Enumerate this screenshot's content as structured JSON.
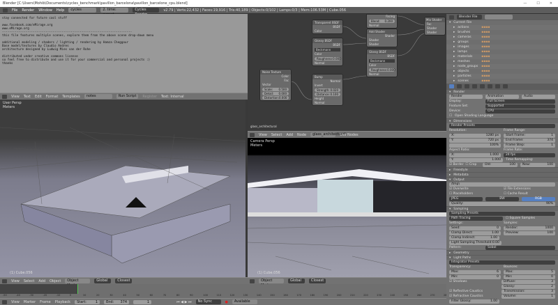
{
  "window": {
    "title": "Blender  [C:\\Users\\Mohib\\Documents\\cycles_benchmark\\pavillon_barcelona\\pavillon_barcelone_cpu.blend]",
    "controls": [
      "—",
      "☐",
      "✕"
    ]
  },
  "infobar": {
    "menus": [
      "File",
      "Render",
      "Window",
      "Help"
    ],
    "layout": "cycles",
    "scene": "2. time: sunset",
    "engine": "Cycles Render",
    "stats": "v2.79 | Verts:22,432 | Faces:19,916 | Tris:40,189 | Objects:0/102 | Lamps:0/3 | Mem:106.53M | Cube.056"
  },
  "text_editor": {
    "lines": [
      "stay connected for future cool stuff",
      "",
      "www.facebook.com/eMirage.org",
      "www.eMirage.org",
      "------------------------------------------------------------------------",
      "this file features multiple scenes, explore them from the above scene drop-down menu",
      "",
      "additional modeling / shaders / lighting / rendering by Hamza Cheggour",
      "Base model/textures by Claudio Andres",
      "architecture designed by Ludwig Mies van der Rohe",
      "",
      "distributed under creative commons license",
      "so feel free to distribute and use it for your commercial and personal projects :)",
      "thanks"
    ],
    "header": {
      "menus": [
        "View",
        "Text",
        "Edit",
        "Format",
        "Templates"
      ],
      "file": "notes",
      "run": "Run Script",
      "register": "Register",
      "status": "Text: Internal"
    }
  },
  "viewport_left": {
    "view": "User Persp",
    "units": "Meters",
    "object": "(1) Cube.056",
    "menus": [
      "View",
      "Select",
      "Add",
      "Object"
    ],
    "mode": "Object Mode",
    "orientation": "Global",
    "pivot": "Closest"
  },
  "viewport_right": {
    "view": "Camera Persp",
    "units": "Meters",
    "object": "(1) Cube.056",
    "mode": "Object Mode",
    "orientation": "Global",
    "pivot": "Closest"
  },
  "node_editor": {
    "material_top": "glass_architectural",
    "header": {
      "menus": [
        "View",
        "Select",
        "Add",
        "Node"
      ],
      "material": "glass_architectural",
      "use_nodes": "Use Nodes"
    },
    "nodes": {
      "transparent": {
        "title": "Transparent BSDF",
        "out": "BSDF",
        "color": "Color"
      },
      "glossy1": {
        "title": "Glossy BSDF",
        "out": "BSDF",
        "dist": "Beckmann",
        "color": "Color",
        "rough_label": "Roughness:",
        "rough": "0.000",
        "normal": "Normal"
      },
      "bump": {
        "title": "Bump",
        "out": "Normal",
        "invert": "Invert",
        "strength_label": "Strength:",
        "strength": "0.020",
        "distance_label": "Distance:",
        "distance": "0.100",
        "height": "Height",
        "normal": "Normal"
      },
      "noise": {
        "title": "Noise Texture",
        "color": "Color",
        "fac": "Fac",
        "vector": "Vector",
        "scale_label": "Scale:",
        "scale": "0.500",
        "detail_label": "Detail:",
        "detail": "0.000",
        "distortion_label": "Distortion:",
        "distortion": "0.000"
      },
      "fresnel": {
        "facing": "Facing",
        "blend_label": "Blend:",
        "blend": "0.200",
        "normal": "Normal"
      },
      "add": {
        "title": "Add Shader",
        "out": "Shader",
        "in1": "Shader",
        "in2": "Shader"
      },
      "glossy2": {
        "title": "Glossy BSDF",
        "out": "BSDF",
        "dist": "Beckmann",
        "color": "Color",
        "rough_label": "Roughness:",
        "rough": "0.000",
        "normal": "Normal"
      },
      "mix": {
        "title": "Mix Shader",
        "fac": "Fac",
        "in1": "Shader",
        "in2": "Shader"
      }
    }
  },
  "timeline": {
    "menus": [
      "View",
      "Marker",
      "Frame",
      "Playback"
    ],
    "start_label": "Start:",
    "start": "1",
    "end_label": "End:",
    "end": "374",
    "current": "1",
    "sync": "No Sync",
    "keying": "Available",
    "ticks": [
      "-50",
      "-40",
      "-30",
      "-20",
      "-10",
      "0",
      "10",
      "20",
      "30",
      "40",
      "50",
      "60",
      "70",
      "80",
      "90",
      "100",
      "110",
      "120",
      "130",
      "140",
      "150",
      "160",
      "170",
      "180",
      "190",
      "200",
      "210",
      "220",
      "230",
      "240",
      "250",
      "260",
      "270",
      "280"
    ]
  },
  "outliner": {
    "view": "Blender File",
    "root": "Current File",
    "items": [
      "actions",
      "brushes",
      "cameras",
      "groups",
      "images",
      "lamps",
      "materials",
      "meshes",
      "node_groups",
      "objects",
      "particles",
      "scenes"
    ]
  },
  "properties": {
    "render": {
      "title": "Render",
      "buttons": [
        "Render",
        "Animation",
        "Audio"
      ],
      "display_label": "Display:",
      "display": "Full Screen",
      "feature_label": "Feature Set:",
      "feature": "Supported",
      "device_label": "Device:",
      "device": "CPU",
      "osl": "Open Shading Language"
    },
    "dimensions": {
      "title": "Dimensions",
      "presets": "Render Presets",
      "resolution": "Resolution:",
      "x": "1280 px",
      "y": "720 px",
      "pct": "100%",
      "frame_range": "Frame Range:",
      "start": "Start Frame:",
      "start_v": "1",
      "end": "End Frame:",
      "end_v": "374",
      "step": "Frame Step:",
      "step_v": "1",
      "aspect": "Aspect Ratio:",
      "ax": "1.000",
      "ay": "1.000",
      "frame_rate": "Frame Rate:",
      "fps": "24 fps",
      "remap": "Time Remapping:",
      "old": "Old:",
      "old_v": "100",
      "new": "New:",
      "new_v": "100",
      "border": "Border",
      "crop": "Crop"
    },
    "collapsed": [
      "Freestyle",
      "Metadata"
    ],
    "output": {
      "title": "Output",
      "path": "/tmp\\",
      "overwrite": "Overwrite",
      "file_ext": "File Extensions",
      "placeholders": "Placeholders",
      "cache": "Cache Result",
      "format": "JPEG",
      "bw": "BW",
      "rgb": "RGB",
      "quality_label": "Quality:",
      "quality": "90%"
    },
    "sampling": {
      "title": "Sampling",
      "presets": "Sampling Presets",
      "method": "Path Tracing",
      "square": "Square Samples",
      "settings": "Settings:",
      "seed": "Seed:",
      "seed_v": "0",
      "clamp_d": "Clamp Direct:",
      "clamp_d_v": "1.00",
      "clamp_i": "Clamp Indirect:",
      "clamp_i_v": "1.00",
      "lst": "Light Sampling Threshold:",
      "lst_v": "0.00",
      "samples": "Samples:",
      "render": "Render:",
      "render_v": "1000",
      "preview": "Preview:",
      "preview_v": "100",
      "pattern_label": "Pattern:",
      "pattern": "Sobol"
    },
    "geometry": "Geometry",
    "light_paths": {
      "title": "Light Paths",
      "presets": "Integrator Presets",
      "transparency": "Transparency:",
      "tmax": "6",
      "tmin": "0",
      "max": "Max:",
      "min": "Min:",
      "shadows": "Shadows",
      "refl": "Reflective Caustics",
      "refr": "Refractive Caustics",
      "filter": "Filter Glossy:",
      "filter_v": "1.00",
      "bounces": "Bounces:",
      "bmax": "5",
      "bmin": "0",
      "diffuse": "Diffuse:",
      "diffuse_v": "3",
      "glossy": "Glossy:",
      "glossy_v": "2",
      "transmission": "Transmission:",
      "transmission_v": "3",
      "volume": "Volume:",
      "volume_v": "1"
    }
  }
}
